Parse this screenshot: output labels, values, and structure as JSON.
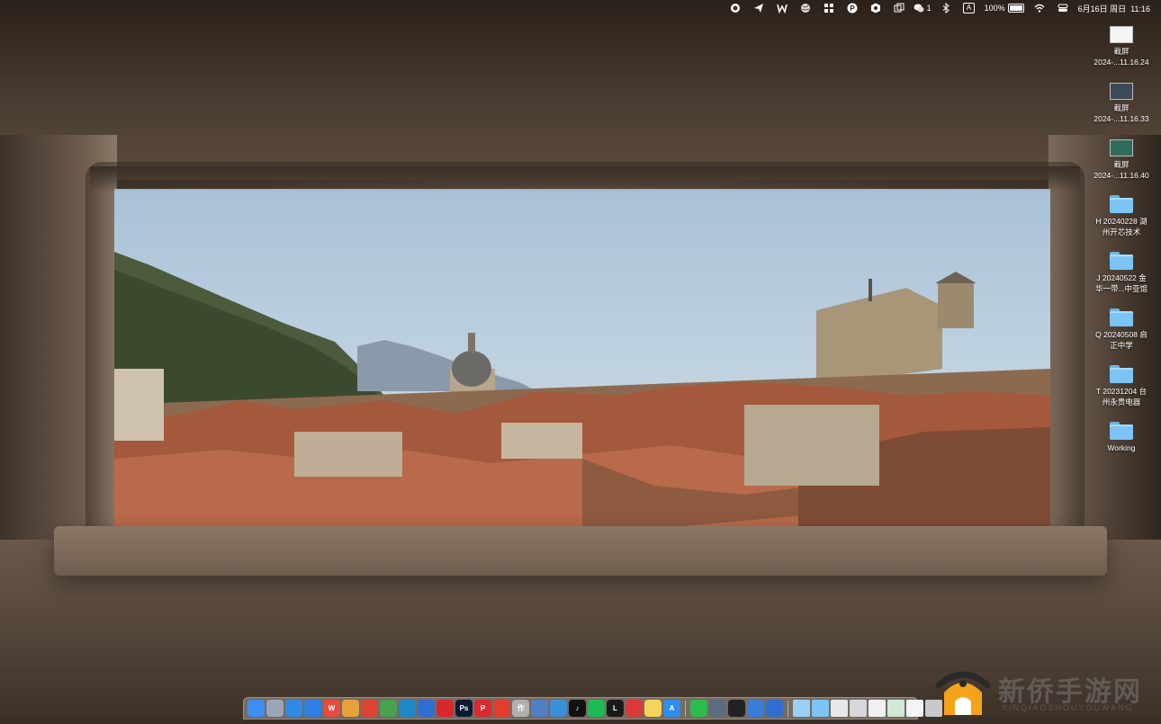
{
  "menubar": {
    "icons": [
      "origin-icon",
      "send-icon",
      "wps-icon",
      "globe-icon",
      "grid-icon",
      "p-icon",
      "hex-icon",
      "windows-icon"
    ],
    "wechat_badge": "1",
    "input_method": "A",
    "battery_percent": "100%",
    "battery_level": 1.0,
    "datetime": "6月16日 周日  11:16"
  },
  "desktop": {
    "items": [
      {
        "type": "screenshot",
        "line1": "截屏",
        "line2": "2024-...11.16.24"
      },
      {
        "type": "screenshot",
        "line1": "截屏",
        "line2": "2024-...11.16.33"
      },
      {
        "type": "screenshot",
        "line1": "截屏",
        "line2": "2024-...11.16.40"
      },
      {
        "type": "folder",
        "line1": "H 20240228 湖",
        "line2": "州开芯技术"
      },
      {
        "type": "folder",
        "line1": "J 20240522 金",
        "line2": "华一带...中亚馆"
      },
      {
        "type": "folder",
        "line1": "Q 20240508 启",
        "line2": "正中学"
      },
      {
        "type": "folder",
        "line1": "T 20231204 台",
        "line2": "州永贵电器"
      },
      {
        "type": "folder",
        "line1": "Working",
        "line2": ""
      }
    ]
  },
  "dock": {
    "apps": [
      {
        "name": "finder",
        "color": "#3d8ef0",
        "glyph": ""
      },
      {
        "name": "launchpad",
        "color": "#9aa6b8",
        "glyph": ""
      },
      {
        "name": "safari",
        "color": "#2f8ae6",
        "glyph": ""
      },
      {
        "name": "mail",
        "color": "#2d7fe3",
        "glyph": ""
      },
      {
        "name": "wps",
        "color": "#e84a3c",
        "glyph": "W"
      },
      {
        "name": "photos",
        "color": "#e8a23c",
        "glyph": ""
      },
      {
        "name": "chrome",
        "color": "#dd4433",
        "glyph": ""
      },
      {
        "name": "chrome-alt",
        "color": "#49a24d",
        "glyph": ""
      },
      {
        "name": "edge",
        "color": "#1e88c8",
        "glyph": ""
      },
      {
        "name": "blue-app",
        "color": "#2e6fd0",
        "glyph": ""
      },
      {
        "name": "acrobat",
        "color": "#d8282c",
        "glyph": ""
      },
      {
        "name": "photoshop",
        "color": "#0b1a33",
        "glyph": "Ps"
      },
      {
        "name": "pinterest",
        "color": "#d82a33",
        "glyph": "P"
      },
      {
        "name": "red-app",
        "color": "#e23d2d",
        "glyph": ""
      },
      {
        "name": "zuo",
        "color": "#b0b0b0",
        "glyph": "作"
      },
      {
        "name": "preview",
        "color": "#4f80c6",
        "glyph": ""
      },
      {
        "name": "globe-app",
        "color": "#3a8fd8",
        "glyph": ""
      },
      {
        "name": "tiktok",
        "color": "#111111",
        "glyph": "♪"
      },
      {
        "name": "spotify",
        "color": "#1db954",
        "glyph": ""
      },
      {
        "name": "l-app",
        "color": "#1a1a1a",
        "glyph": "L"
      },
      {
        "name": "netease-music",
        "color": "#d83a3a",
        "glyph": ""
      },
      {
        "name": "notes",
        "color": "#f6d45a",
        "glyph": ""
      },
      {
        "name": "app-store",
        "color": "#2d8df0",
        "glyph": "A"
      },
      {
        "name": "wechat",
        "color": "#2dbb4e",
        "glyph": ""
      },
      {
        "name": "screen-app",
        "color": "#5a6d80",
        "glyph": ""
      },
      {
        "name": "dark-app",
        "color": "#222222",
        "glyph": ""
      },
      {
        "name": "cloud-app",
        "color": "#3a7bd8",
        "glyph": ""
      },
      {
        "name": "blue-circle-app",
        "color": "#2f6fcf",
        "glyph": ""
      }
    ],
    "stacks": [
      {
        "name": "folder-stack-1",
        "color": "#9bd0f6"
      },
      {
        "name": "folder-stack-2",
        "color": "#7cc4f4"
      },
      {
        "name": "doc-stack-1",
        "color": "#e8e8e8"
      },
      {
        "name": "doc-stack-2",
        "color": "#d8d8d8"
      },
      {
        "name": "doc-stack-3",
        "color": "#f0f0f0"
      },
      {
        "name": "doc-stack-4",
        "color": "#cfe8d8"
      },
      {
        "name": "doc-stack-5",
        "color": "#f4f4f4"
      },
      {
        "name": "trash",
        "color": "#c8c8c8"
      }
    ]
  },
  "watermark": {
    "title": "新侨手游网",
    "subtitle": "XINQIAOSHOUYOUWANG"
  }
}
